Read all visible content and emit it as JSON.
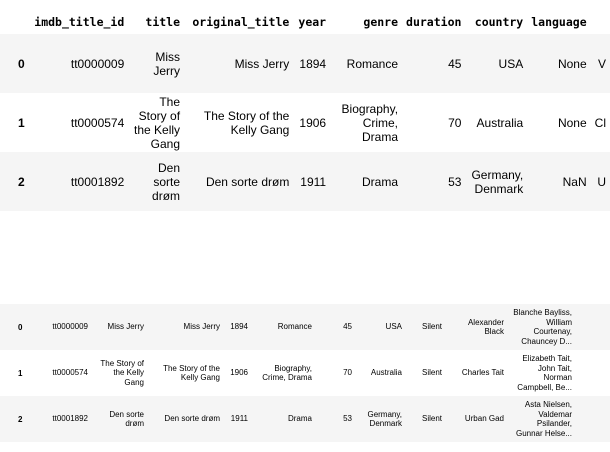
{
  "top_table": {
    "columns": [
      "imdb_title_id",
      "title",
      "original_title",
      "year",
      "genre",
      "duration",
      "country",
      "language"
    ],
    "rows": [
      {
        "index": "0",
        "cells": [
          "tt0000009",
          "Miss Jerry",
          "Miss Jerry",
          "1894",
          "Romance",
          "45",
          "USA",
          "None"
        ],
        "cut": "V"
      },
      {
        "index": "1",
        "cells": [
          "tt0000574",
          "The Story of the Kelly Gang",
          "The Story of the Kelly Gang",
          "1906",
          "Biography, Crime, Drama",
          "70",
          "Australia",
          "None"
        ],
        "cut": "Cl"
      },
      {
        "index": "2",
        "cells": [
          "tt0001892",
          "Den sorte drøm",
          "Den sorte drøm",
          "1911",
          "Drama",
          "53",
          "Germany, Denmark",
          "NaN"
        ],
        "cut": "U"
      }
    ]
  },
  "bottom_table": {
    "rows": [
      {
        "index": "0",
        "cells": [
          "tt0000009",
          "Miss Jerry",
          "Miss Jerry",
          "1894",
          "Romance",
          "45",
          "USA",
          "Silent",
          "Alexander Black",
          "Blanche Bayliss, William Courtenay, Chauncey D..."
        ],
        "cut": ""
      },
      {
        "index": "1",
        "cells": [
          "tt0000574",
          "The Story of the Kelly Gang",
          "The Story of the Kelly Gang",
          "1906",
          "Biography, Crime, Drama",
          "70",
          "Australia",
          "Silent",
          "Charles Tait",
          "Elizabeth Tait, John Tait, Norman Campbell, Be..."
        ],
        "cut": ""
      },
      {
        "index": "2",
        "cells": [
          "tt0001892",
          "Den sorte drøm",
          "Den sorte drøm",
          "1911",
          "Drama",
          "53",
          "Germany, Denmark",
          "Silent",
          "Urban Gad",
          "Asta Nielsen, Valdemar Psilander, Gunnar Helse..."
        ],
        "cut": ""
      }
    ]
  }
}
